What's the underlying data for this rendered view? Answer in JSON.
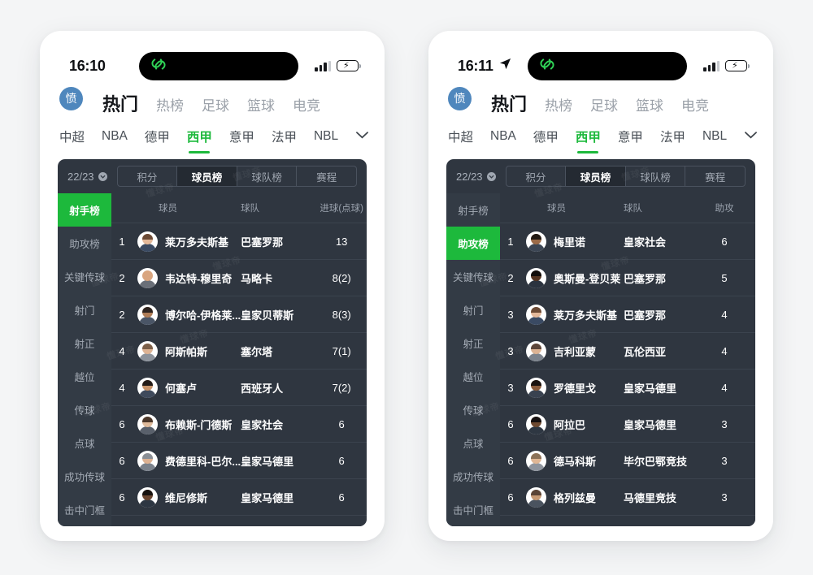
{
  "page": {
    "background": "#f4f5f6",
    "accent_green": "#1db93c",
    "panel_bg": "#2f3640"
  },
  "watermark_text": "懂球帝",
  "panels": [
    {
      "status": {
        "time": "16:10",
        "has_location_arrow": false,
        "location_icon": "location-arrow-icon",
        "island_logo": "rings-logo-icon",
        "signal_icon": "signal-bars-icon",
        "battery_icon": "battery-charging-icon",
        "battery_charging": true
      },
      "avatar": {
        "label": "愤",
        "color": "#4f87bd"
      },
      "nav_tabs": [
        {
          "label": "热门",
          "active": true
        },
        {
          "label": "热榜",
          "active": false
        },
        {
          "label": "足球",
          "active": false
        },
        {
          "label": "篮球",
          "active": false
        },
        {
          "label": "电竞",
          "active": false
        }
      ],
      "leagues": [
        {
          "label": "中超",
          "active": false
        },
        {
          "label": "NBA",
          "active": false
        },
        {
          "label": "德甲",
          "active": false
        },
        {
          "label": "西甲",
          "active": true
        },
        {
          "label": "意甲",
          "active": false
        },
        {
          "label": "法甲",
          "active": false
        },
        {
          "label": "NBL",
          "active": false
        }
      ],
      "league_expand_icon": "chevron-down-icon",
      "season": {
        "label": "22/23",
        "icon": "dropdown-circle-icon"
      },
      "segments": [
        {
          "label": "积分",
          "active": false
        },
        {
          "label": "球员榜",
          "active": true
        },
        {
          "label": "球队榜",
          "active": false
        },
        {
          "label": "赛程",
          "active": false
        }
      ],
      "side_items": [
        {
          "label": "射手榜",
          "active": true
        },
        {
          "label": "助攻榜",
          "active": false
        },
        {
          "label": "关键传球",
          "active": false
        },
        {
          "label": "射门",
          "active": false
        },
        {
          "label": "射正",
          "active": false
        },
        {
          "label": "越位",
          "active": false
        },
        {
          "label": "传球",
          "active": false
        },
        {
          "label": "点球",
          "active": false
        },
        {
          "label": "成功传球",
          "active": false
        },
        {
          "label": "击中门框",
          "active": false
        }
      ],
      "table": {
        "headers": {
          "player": "球员",
          "team": "球队",
          "value": "进球(点球)"
        },
        "rows": [
          {
            "rank": "1",
            "player": "莱万多夫斯基",
            "team": "巴塞罗那",
            "value": "13",
            "skin": "#e3b89a",
            "hair": "#6b4a35",
            "shirt": "#3a4a63"
          },
          {
            "rank": "2",
            "player": "韦达特-穆里奇",
            "team": "马略卡",
            "value": "8(2)",
            "skin": "#d9a57f",
            "hair": "#casa",
            "shirt": "#6a6f78"
          },
          {
            "rank": "2",
            "player": "博尔哈-伊格莱...",
            "team": "皇家贝蒂斯",
            "value": "8(3)",
            "skin": "#b07d57",
            "hair": "#2e2420",
            "shirt": "#4a5566"
          },
          {
            "rank": "4",
            "player": "阿斯帕斯",
            "team": "塞尔塔",
            "value": "7(1)",
            "skin": "#ddb394",
            "hair": "#7d6049",
            "shirt": "#8d939c"
          },
          {
            "rank": "4",
            "player": "何塞卢",
            "team": "西班牙人",
            "value": "7(2)",
            "skin": "#c8946b",
            "hair": "#241c18",
            "shirt": "#3f4a5c"
          },
          {
            "rank": "6",
            "player": "布赖斯-门德斯",
            "team": "皇家社会",
            "value": "6",
            "skin": "#e0bb9c",
            "hair": "#4b372a",
            "shirt": "#59606b"
          },
          {
            "rank": "6",
            "player": "费德里科-巴尔...",
            "team": "皇家马德里",
            "value": "6",
            "skin": "#dcb192",
            "hair": "#8a8f96",
            "shirt": "#7b828c"
          },
          {
            "rank": "6",
            "player": "维尼修斯",
            "team": "皇家马德里",
            "value": "6",
            "skin": "#6b4630",
            "hair": "#18120f",
            "shirt": "#2d3642"
          }
        ]
      }
    },
    {
      "status": {
        "time": "16:11",
        "has_location_arrow": true,
        "location_icon": "location-arrow-icon",
        "island_logo": "rings-logo-icon",
        "signal_icon": "signal-bars-icon",
        "battery_icon": "battery-charging-icon",
        "battery_charging": true
      },
      "avatar": {
        "label": "愤",
        "color": "#4f87bd"
      },
      "nav_tabs": [
        {
          "label": "热门",
          "active": true
        },
        {
          "label": "热榜",
          "active": false
        },
        {
          "label": "足球",
          "active": false
        },
        {
          "label": "篮球",
          "active": false
        },
        {
          "label": "电竞",
          "active": false
        }
      ],
      "leagues": [
        {
          "label": "中超",
          "active": false
        },
        {
          "label": "NBA",
          "active": false
        },
        {
          "label": "德甲",
          "active": false
        },
        {
          "label": "西甲",
          "active": true
        },
        {
          "label": "意甲",
          "active": false
        },
        {
          "label": "法甲",
          "active": false
        },
        {
          "label": "NBL",
          "active": false
        }
      ],
      "league_expand_icon": "chevron-down-icon",
      "season": {
        "label": "22/23",
        "icon": "dropdown-circle-icon"
      },
      "segments": [
        {
          "label": "积分",
          "active": false
        },
        {
          "label": "球员榜",
          "active": true
        },
        {
          "label": "球队榜",
          "active": false
        },
        {
          "label": "赛程",
          "active": false
        }
      ],
      "side_items": [
        {
          "label": "射手榜",
          "active": false
        },
        {
          "label": "助攻榜",
          "active": true
        },
        {
          "label": "关键传球",
          "active": false
        },
        {
          "label": "射门",
          "active": false
        },
        {
          "label": "射正",
          "active": false
        },
        {
          "label": "越位",
          "active": false
        },
        {
          "label": "传球",
          "active": false
        },
        {
          "label": "点球",
          "active": false
        },
        {
          "label": "成功传球",
          "active": false
        },
        {
          "label": "击中门框",
          "active": false
        }
      ],
      "table": {
        "headers": {
          "player": "球员",
          "team": "球队",
          "value": "助攻"
        },
        "rows": [
          {
            "rank": "1",
            "player": "梅里诺",
            "team": "皇家社会",
            "value": "6",
            "skin": "#9c6b48",
            "hair": "#221a14",
            "shirt": "#3c4654"
          },
          {
            "rank": "2",
            "player": "奥斯曼-登贝莱",
            "team": "巴塞罗那",
            "value": "5",
            "skin": "#54331f",
            "hair": "#120d0a",
            "shirt": "#2b333f"
          },
          {
            "rank": "3",
            "player": "莱万多夫斯基",
            "team": "巴塞罗那",
            "value": "4",
            "skin": "#e3b89a",
            "hair": "#6b4a35",
            "shirt": "#3a4a63"
          },
          {
            "rank": "3",
            "player": "吉利亚蒙",
            "team": "瓦伦西亚",
            "value": "4",
            "skin": "#dcb394",
            "hair": "#5d463a",
            "shirt": "#7c838d"
          },
          {
            "rank": "3",
            "player": "罗德里戈",
            "team": "皇家马德里",
            "value": "4",
            "skin": "#8a5c3c",
            "hair": "#1a1310",
            "shirt": "#394250"
          },
          {
            "rank": "6",
            "player": "阿拉巴",
            "team": "皇家马德里",
            "value": "3",
            "skin": "#6f4a31",
            "hair": "#151010",
            "shirt": "#2e3742"
          },
          {
            "rank": "6",
            "player": "德马科斯",
            "team": "毕尔巴鄂竞技",
            "value": "3",
            "skin": "#e0b795",
            "hair": "#8c7258",
            "shirt": "#8f959e"
          },
          {
            "rank": "6",
            "player": "格列兹曼",
            "team": "马德里竞技",
            "value": "3",
            "skin": "#c79a74",
            "hair": "#5a4436",
            "shirt": "#4a535f"
          }
        ]
      }
    }
  ]
}
